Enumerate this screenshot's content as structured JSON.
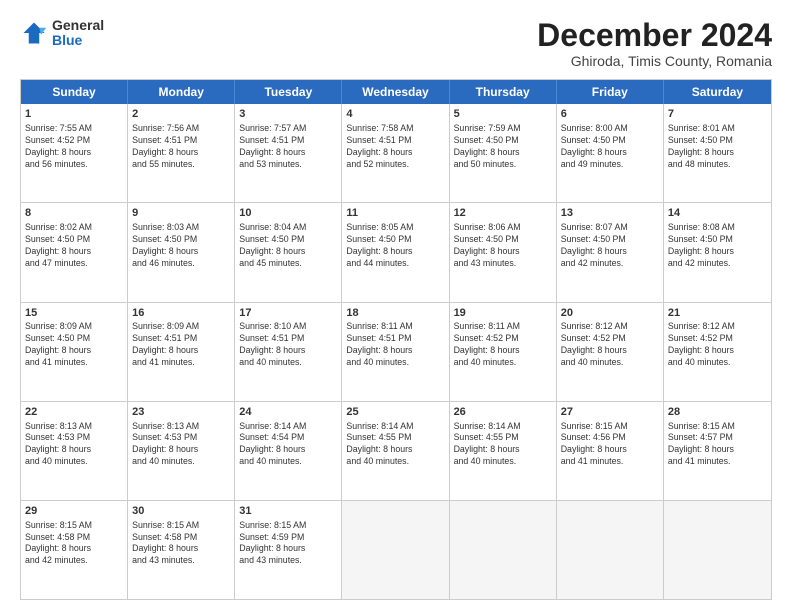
{
  "logo": {
    "general": "General",
    "blue": "Blue"
  },
  "title": "December 2024",
  "subtitle": "Ghiroda, Timis County, Romania",
  "days": [
    "Sunday",
    "Monday",
    "Tuesday",
    "Wednesday",
    "Thursday",
    "Friday",
    "Saturday"
  ],
  "weeks": [
    [
      {
        "num": "1",
        "info": "Sunrise: 7:55 AM\nSunset: 4:52 PM\nDaylight: 8 hours\nand 56 minutes."
      },
      {
        "num": "2",
        "info": "Sunrise: 7:56 AM\nSunset: 4:51 PM\nDaylight: 8 hours\nand 55 minutes."
      },
      {
        "num": "3",
        "info": "Sunrise: 7:57 AM\nSunset: 4:51 PM\nDaylight: 8 hours\nand 53 minutes."
      },
      {
        "num": "4",
        "info": "Sunrise: 7:58 AM\nSunset: 4:51 PM\nDaylight: 8 hours\nand 52 minutes."
      },
      {
        "num": "5",
        "info": "Sunrise: 7:59 AM\nSunset: 4:50 PM\nDaylight: 8 hours\nand 50 minutes."
      },
      {
        "num": "6",
        "info": "Sunrise: 8:00 AM\nSunset: 4:50 PM\nDaylight: 8 hours\nand 49 minutes."
      },
      {
        "num": "7",
        "info": "Sunrise: 8:01 AM\nSunset: 4:50 PM\nDaylight: 8 hours\nand 48 minutes."
      }
    ],
    [
      {
        "num": "8",
        "info": "Sunrise: 8:02 AM\nSunset: 4:50 PM\nDaylight: 8 hours\nand 47 minutes."
      },
      {
        "num": "9",
        "info": "Sunrise: 8:03 AM\nSunset: 4:50 PM\nDaylight: 8 hours\nand 46 minutes."
      },
      {
        "num": "10",
        "info": "Sunrise: 8:04 AM\nSunset: 4:50 PM\nDaylight: 8 hours\nand 45 minutes."
      },
      {
        "num": "11",
        "info": "Sunrise: 8:05 AM\nSunset: 4:50 PM\nDaylight: 8 hours\nand 44 minutes."
      },
      {
        "num": "12",
        "info": "Sunrise: 8:06 AM\nSunset: 4:50 PM\nDaylight: 8 hours\nand 43 minutes."
      },
      {
        "num": "13",
        "info": "Sunrise: 8:07 AM\nSunset: 4:50 PM\nDaylight: 8 hours\nand 42 minutes."
      },
      {
        "num": "14",
        "info": "Sunrise: 8:08 AM\nSunset: 4:50 PM\nDaylight: 8 hours\nand 42 minutes."
      }
    ],
    [
      {
        "num": "15",
        "info": "Sunrise: 8:09 AM\nSunset: 4:50 PM\nDaylight: 8 hours\nand 41 minutes."
      },
      {
        "num": "16",
        "info": "Sunrise: 8:09 AM\nSunset: 4:51 PM\nDaylight: 8 hours\nand 41 minutes."
      },
      {
        "num": "17",
        "info": "Sunrise: 8:10 AM\nSunset: 4:51 PM\nDaylight: 8 hours\nand 40 minutes."
      },
      {
        "num": "18",
        "info": "Sunrise: 8:11 AM\nSunset: 4:51 PM\nDaylight: 8 hours\nand 40 minutes."
      },
      {
        "num": "19",
        "info": "Sunrise: 8:11 AM\nSunset: 4:52 PM\nDaylight: 8 hours\nand 40 minutes."
      },
      {
        "num": "20",
        "info": "Sunrise: 8:12 AM\nSunset: 4:52 PM\nDaylight: 8 hours\nand 40 minutes."
      },
      {
        "num": "21",
        "info": "Sunrise: 8:12 AM\nSunset: 4:52 PM\nDaylight: 8 hours\nand 40 minutes."
      }
    ],
    [
      {
        "num": "22",
        "info": "Sunrise: 8:13 AM\nSunset: 4:53 PM\nDaylight: 8 hours\nand 40 minutes."
      },
      {
        "num": "23",
        "info": "Sunrise: 8:13 AM\nSunset: 4:53 PM\nDaylight: 8 hours\nand 40 minutes."
      },
      {
        "num": "24",
        "info": "Sunrise: 8:14 AM\nSunset: 4:54 PM\nDaylight: 8 hours\nand 40 minutes."
      },
      {
        "num": "25",
        "info": "Sunrise: 8:14 AM\nSunset: 4:55 PM\nDaylight: 8 hours\nand 40 minutes."
      },
      {
        "num": "26",
        "info": "Sunrise: 8:14 AM\nSunset: 4:55 PM\nDaylight: 8 hours\nand 40 minutes."
      },
      {
        "num": "27",
        "info": "Sunrise: 8:15 AM\nSunset: 4:56 PM\nDaylight: 8 hours\nand 41 minutes."
      },
      {
        "num": "28",
        "info": "Sunrise: 8:15 AM\nSunset: 4:57 PM\nDaylight: 8 hours\nand 41 minutes."
      }
    ],
    [
      {
        "num": "29",
        "info": "Sunrise: 8:15 AM\nSunset: 4:58 PM\nDaylight: 8 hours\nand 42 minutes."
      },
      {
        "num": "30",
        "info": "Sunrise: 8:15 AM\nSunset: 4:58 PM\nDaylight: 8 hours\nand 43 minutes."
      },
      {
        "num": "31",
        "info": "Sunrise: 8:15 AM\nSunset: 4:59 PM\nDaylight: 8 hours\nand 43 minutes."
      },
      {
        "num": "",
        "info": ""
      },
      {
        "num": "",
        "info": ""
      },
      {
        "num": "",
        "info": ""
      },
      {
        "num": "",
        "info": ""
      }
    ]
  ]
}
